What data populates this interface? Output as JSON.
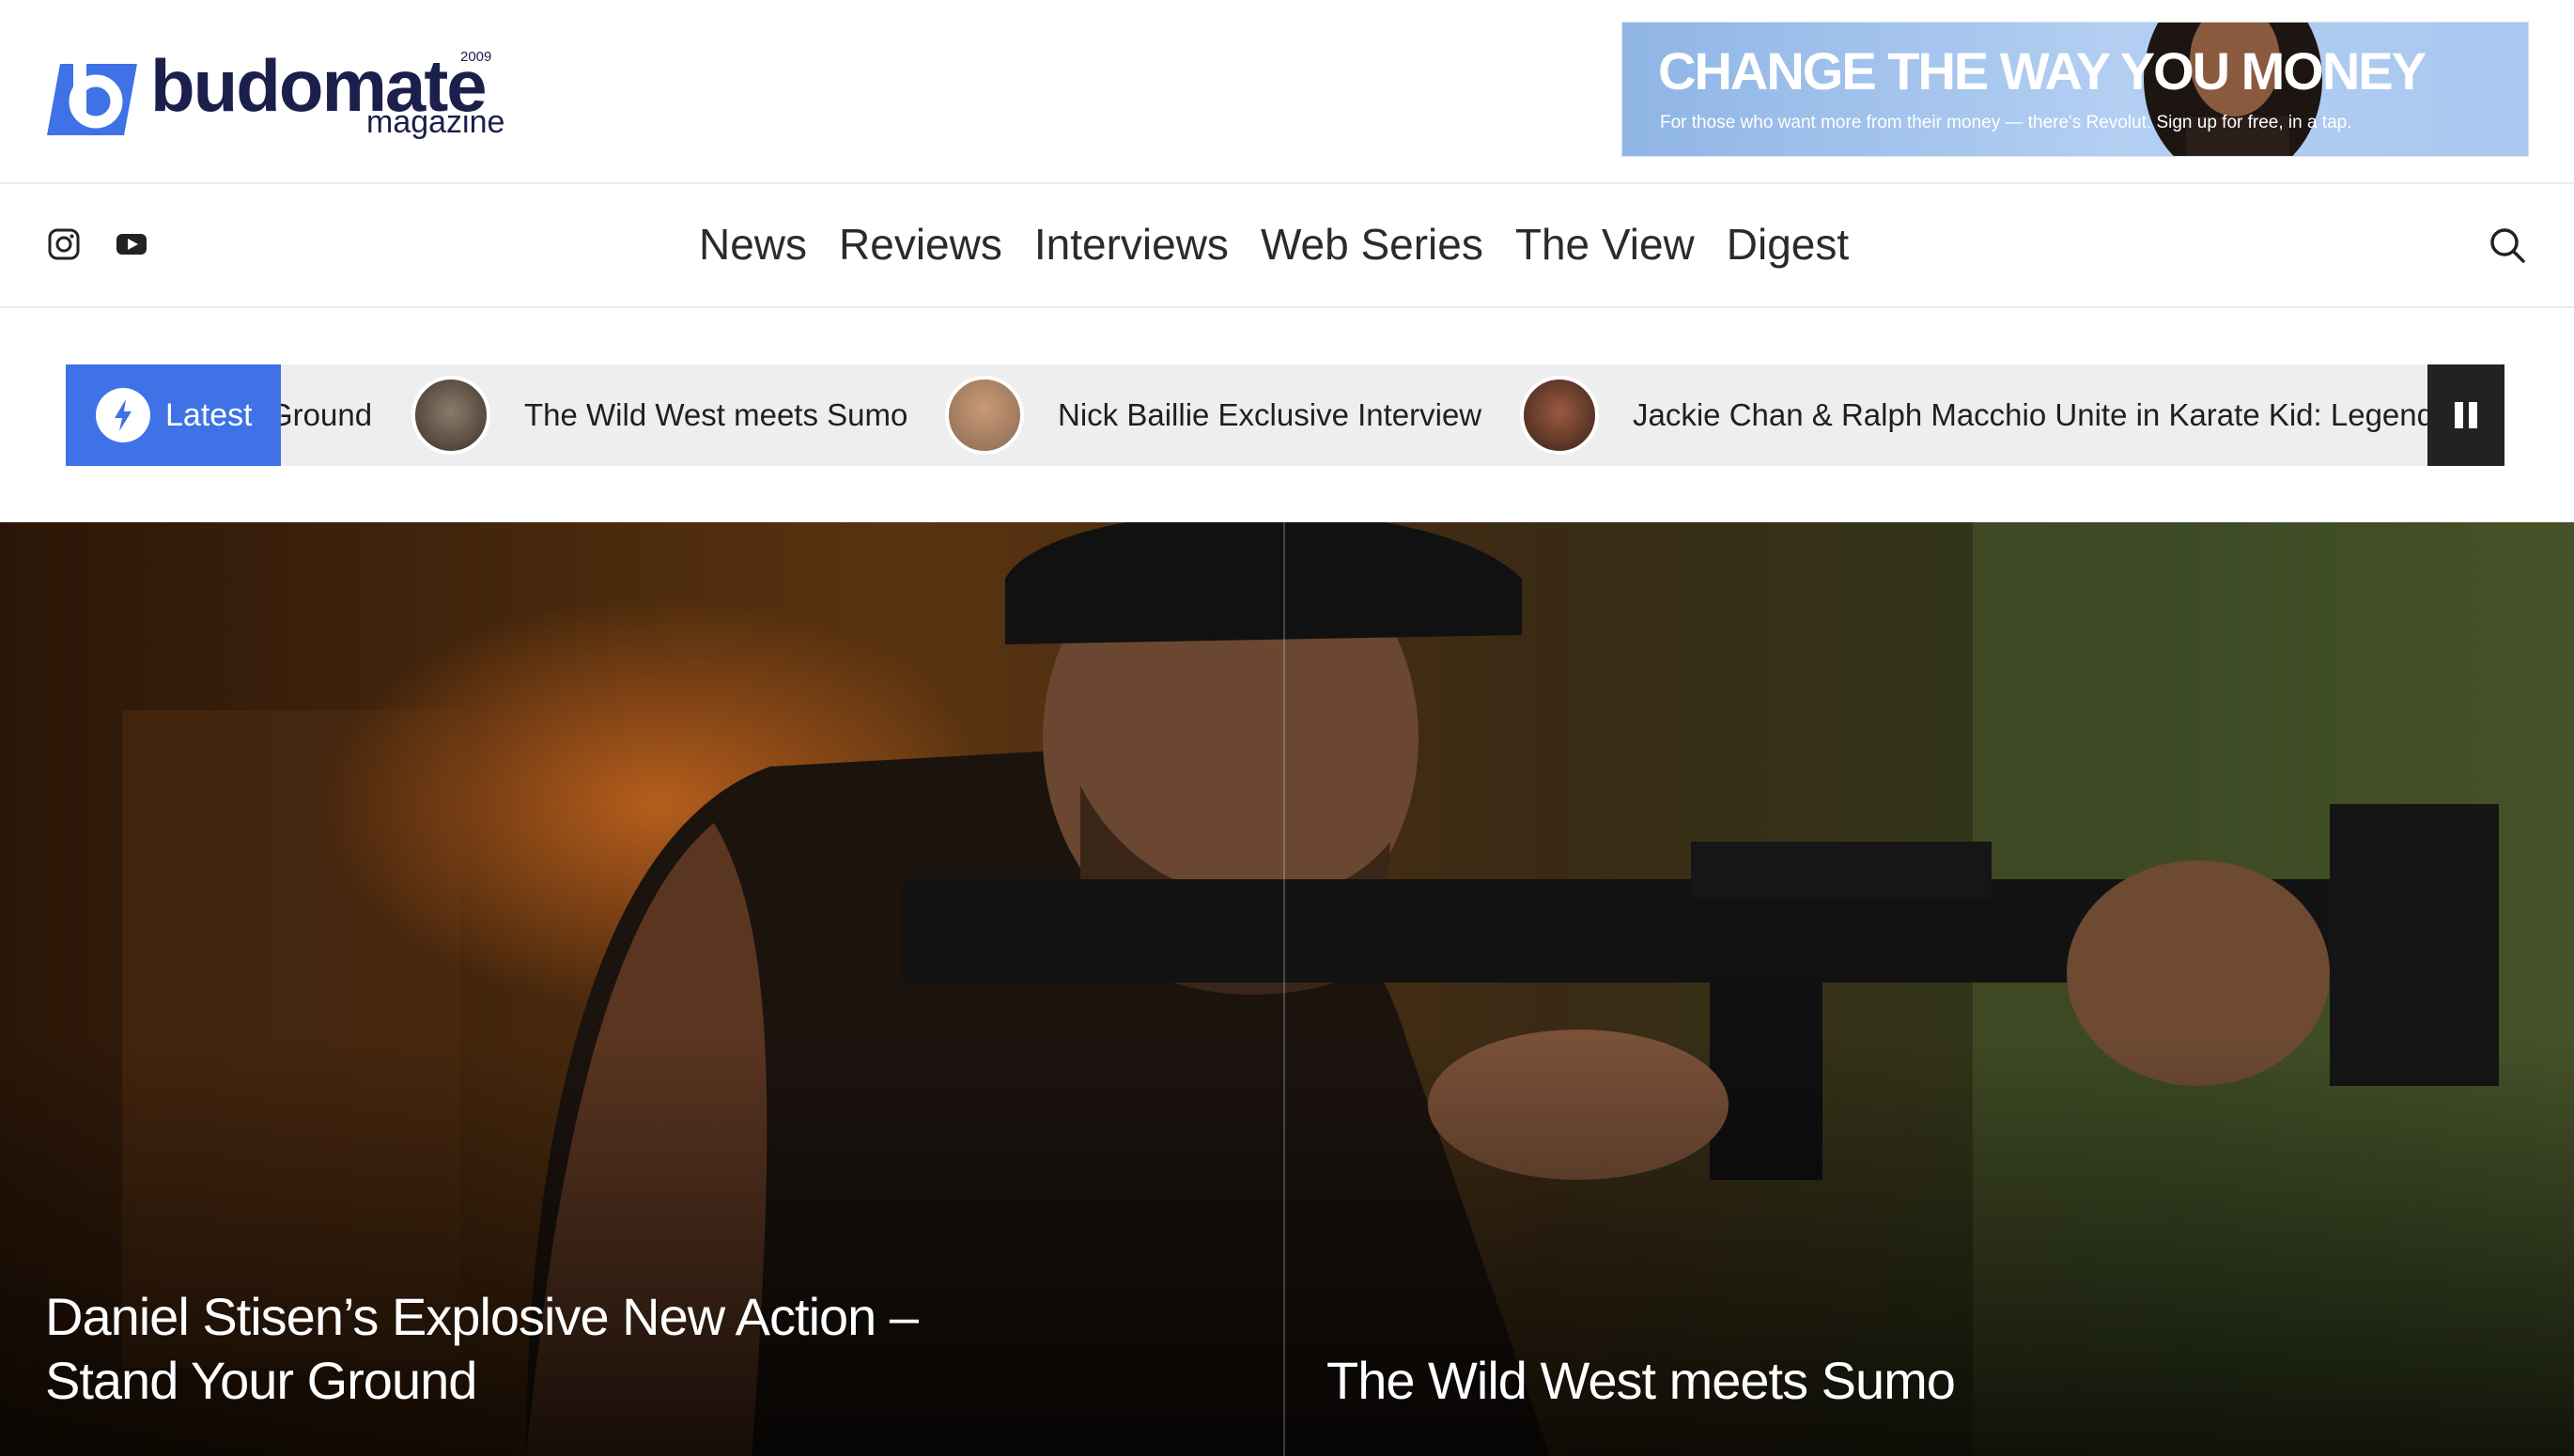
{
  "logo": {
    "wordmark": "budomate",
    "year": "2009",
    "subtitle": "magazine"
  },
  "ad": {
    "headline": "CHANGE THE WAY YOU MONEY",
    "subtext": "For those who want more from their money — there's Revolut. Sign up for free, in a tap."
  },
  "nav": {
    "social": [
      {
        "icon": "instagram-icon"
      },
      {
        "icon": "youtube-icon"
      }
    ],
    "menu": [
      "News",
      "Reviews",
      "Interviews",
      "Web Series",
      "The View",
      "Digest"
    ],
    "search_icon": "search-icon"
  },
  "ticker": {
    "label": "Latest",
    "items": [
      {
        "title": "Ground"
      },
      {
        "title": "The Wild West meets Sumo"
      },
      {
        "title": "Nick Baillie Exclusive Interview"
      },
      {
        "title": "Jackie Chan & Ralph Macchio Unite in Karate Kid: Legends"
      }
    ],
    "pause_icon": "pause-icon"
  },
  "hero": {
    "left_title": "Daniel Stisen’s Explosive New Action – Stand Your Ground",
    "right_title": "The Wild West meets Sumo"
  },
  "colors": {
    "accent": "#3e72e6",
    "brand": "#1b1f4b",
    "pause_bg": "#222222"
  }
}
